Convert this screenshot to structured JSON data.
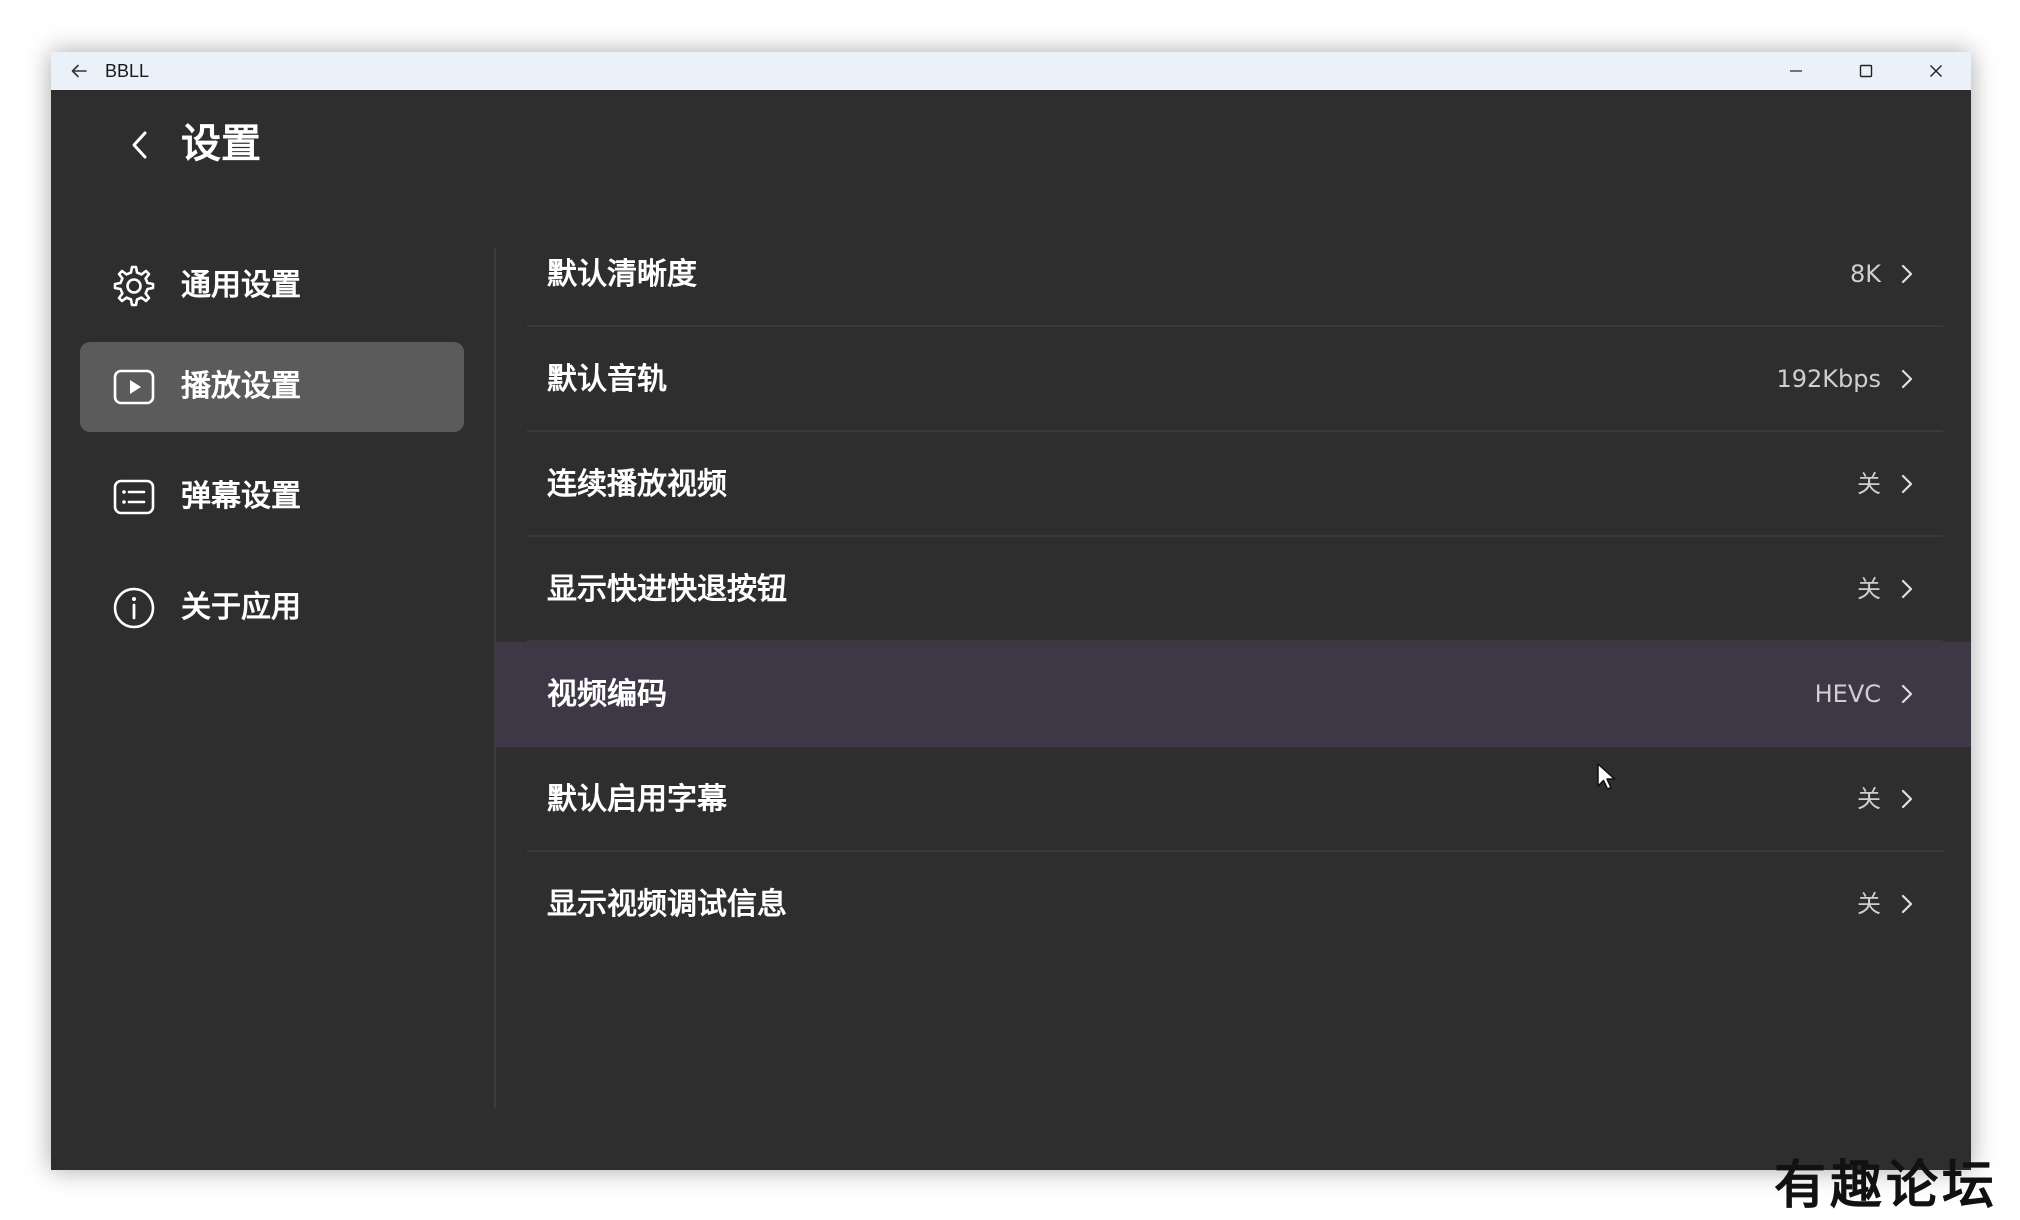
{
  "window": {
    "title": "BBLL"
  },
  "header": {
    "title": "设置"
  },
  "sidebar": {
    "items": [
      {
        "label": "通用设置",
        "icon": "gear-icon",
        "active": false
      },
      {
        "label": "播放设置",
        "icon": "play-icon",
        "active": true
      },
      {
        "label": "弹幕设置",
        "icon": "danmaku-icon",
        "active": false
      },
      {
        "label": "关于应用",
        "icon": "info-icon",
        "active": false
      }
    ]
  },
  "settings": [
    {
      "label": "默认清晰度",
      "value": "8K"
    },
    {
      "label": "默认音轨",
      "value": "192Kbps"
    },
    {
      "label": "连续播放视频",
      "value": "关"
    },
    {
      "label": "显示快进快退按钮",
      "value": "关"
    },
    {
      "label": "视频编码",
      "value": "HEVC",
      "hover": true
    },
    {
      "label": "默认启用字幕",
      "value": "关"
    },
    {
      "label": "显示视频调试信息",
      "value": "关"
    }
  ],
  "watermark": "有趣论坛",
  "colors": {
    "background": "#2e2e2e",
    "titlebar": "#eaf1f9",
    "active_item": "#5b5b5b",
    "hover_row": "#3d3746",
    "text": "#ffffff",
    "value_text": "#cfcfcf"
  }
}
